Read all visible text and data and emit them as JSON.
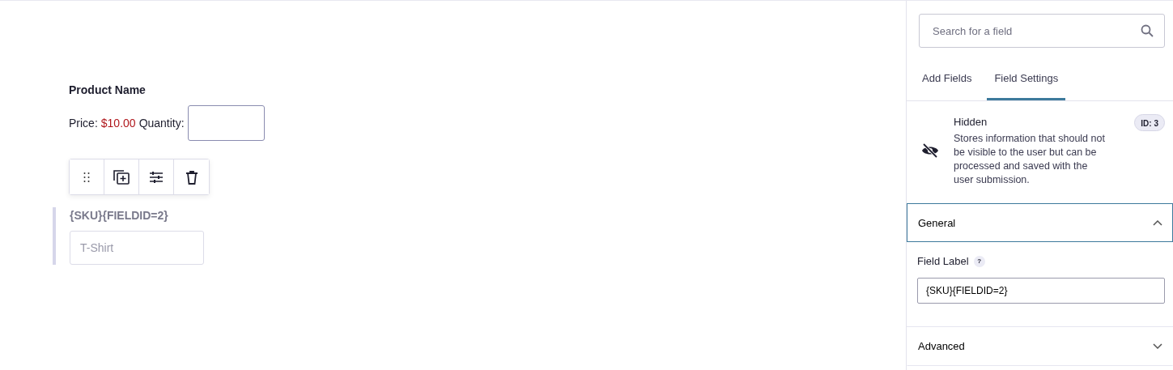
{
  "canvas": {
    "product_name": "Product Name",
    "price_label": "Price:",
    "price_value": "$10.00",
    "quantity_label": "Quantity:",
    "selected_field": {
      "label": "{SKU}{FIELDID=2}",
      "placeholder": "T-Shirt"
    }
  },
  "sidebar": {
    "search": {
      "placeholder": "Search for a field"
    },
    "tabs": [
      {
        "label": "Add Fields",
        "selected": false
      },
      {
        "label": "Field Settings",
        "selected": true
      }
    ],
    "field_info": {
      "title": "Hidden",
      "description": "Stores information that should not be visible to the user but can be processed and saved with the user submission.",
      "id_badge": "ID: 3"
    },
    "sections": [
      {
        "title": "General",
        "expanded": true,
        "field_label": "Field Label",
        "help": "?",
        "value": "{SKU}{FIELDID=2}"
      },
      {
        "title": "Advanced",
        "expanded": false
      }
    ]
  }
}
